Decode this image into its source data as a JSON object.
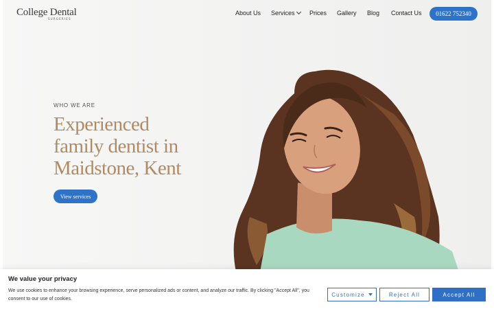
{
  "brand": {
    "name": "College Dental",
    "sub": "SURGERIES"
  },
  "nav": {
    "items": [
      {
        "label": "About Us"
      },
      {
        "label": "Services"
      },
      {
        "label": "Prices"
      },
      {
        "label": "Gallery"
      },
      {
        "label": "Blog"
      },
      {
        "label": "Contact Us"
      }
    ],
    "phone": "01622 752340"
  },
  "hero": {
    "eyebrow": "WHO WE ARE",
    "headline_lines": [
      "Experienced",
      "family dentist in",
      "Maidstone, Kent"
    ],
    "cta": "View services"
  },
  "cookie": {
    "title": "We value your privacy",
    "text": "We use cookies to enhance your browsing experience, serve personalized ads or content, and analyze our traffic. By clicking \"Accept All\", you consent to our use of cookies.",
    "customize": "Customize",
    "reject": "Reject All",
    "accept": "Accept All"
  },
  "colors": {
    "brand_blue": "#2f73c9",
    "headline_gold": "#b08a63",
    "hero_bg": "#f3f3f2"
  }
}
